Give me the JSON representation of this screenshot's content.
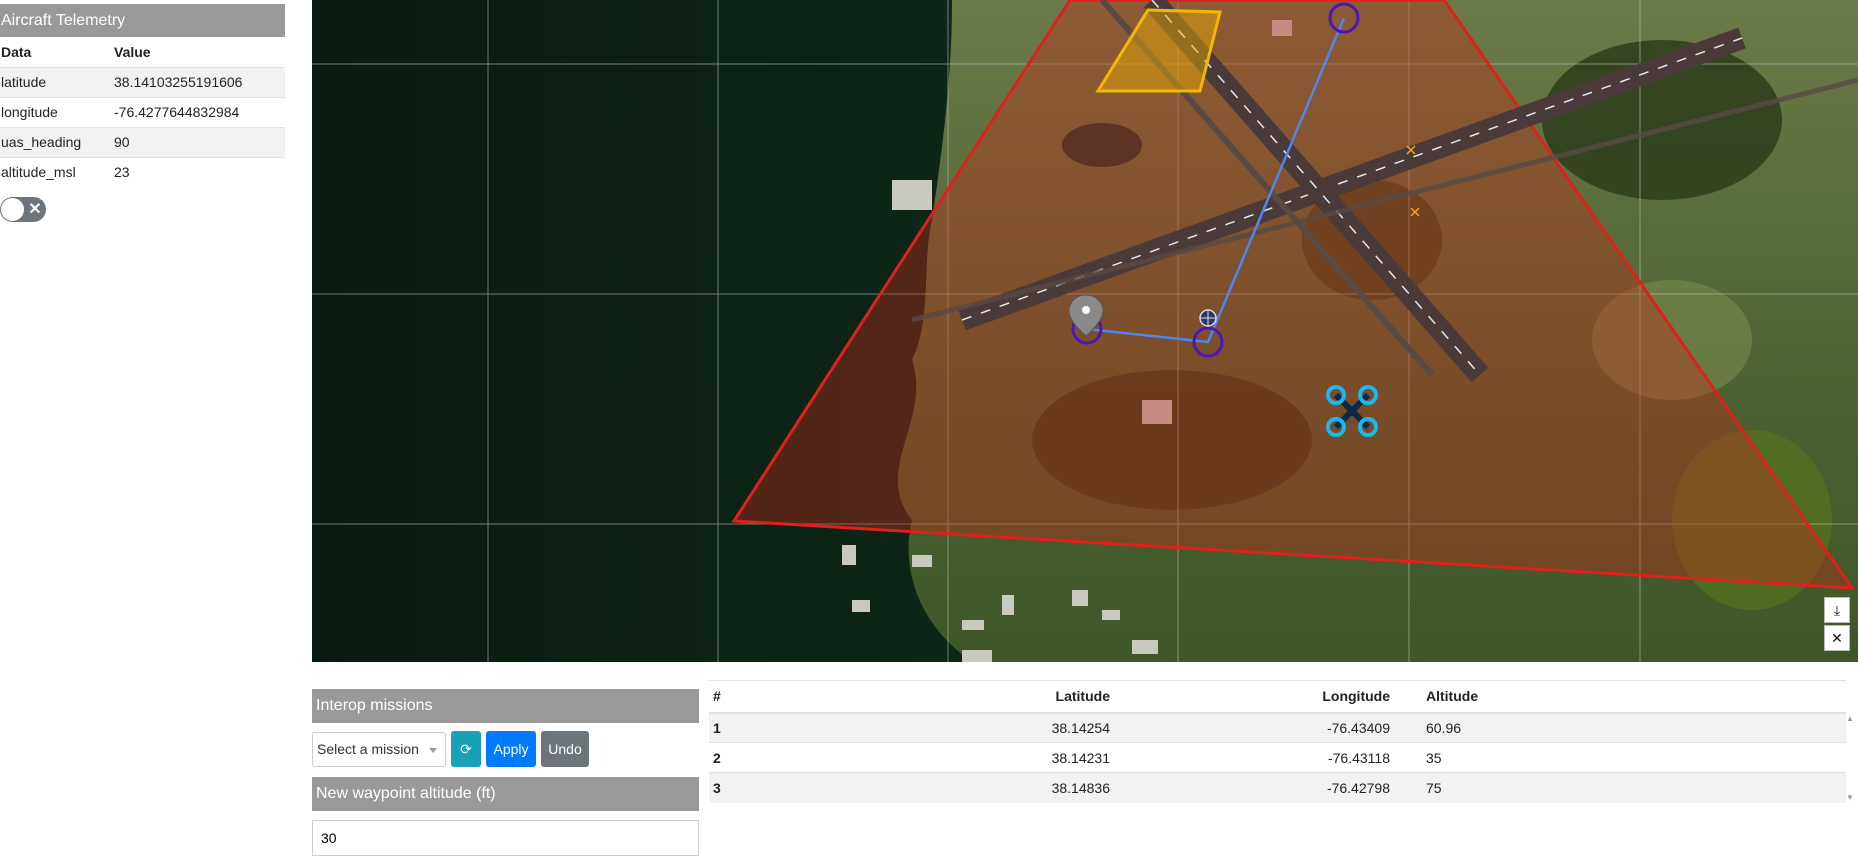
{
  "telemetry": {
    "title": "Aircraft Telemetry",
    "columns": [
      "Data",
      "Value"
    ],
    "rows": [
      {
        "key": "latitude",
        "value": "38.14103255191606"
      },
      {
        "key": "longitude",
        "value": "-76.4277644832984"
      },
      {
        "key": "uas_heading",
        "value": "90"
      },
      {
        "key": "altitude_msl",
        "value": "23"
      }
    ],
    "toggle_icon": "close-x"
  },
  "map": {
    "boundary_color": "#e0201c",
    "route_color": "#4f86f0",
    "search_area_color": "#f0b000",
    "waypoint_color": "#4a18b8",
    "drone_color": "#1ab8f0",
    "controls": [
      "download-icon",
      "close-icon"
    ]
  },
  "missions": {
    "title": "Interop missions",
    "select_placeholder": "Select a mission",
    "refresh_icon": "refresh-icon",
    "apply_label": "Apply",
    "undo_label": "Undo"
  },
  "new_waypoint": {
    "title": "New waypoint altitude (ft)",
    "value": "30"
  },
  "waypoints": {
    "columns": [
      "#",
      "Latitude",
      "Longitude",
      "Altitude"
    ],
    "rows": [
      {
        "n": "1",
        "lat": "38.14254",
        "lon": "-76.43409",
        "alt": "60.96"
      },
      {
        "n": "2",
        "lat": "38.14231",
        "lon": "-76.43118",
        "alt": "35"
      },
      {
        "n": "3",
        "lat": "38.14836",
        "lon": "-76.42798",
        "alt": "75"
      }
    ]
  }
}
